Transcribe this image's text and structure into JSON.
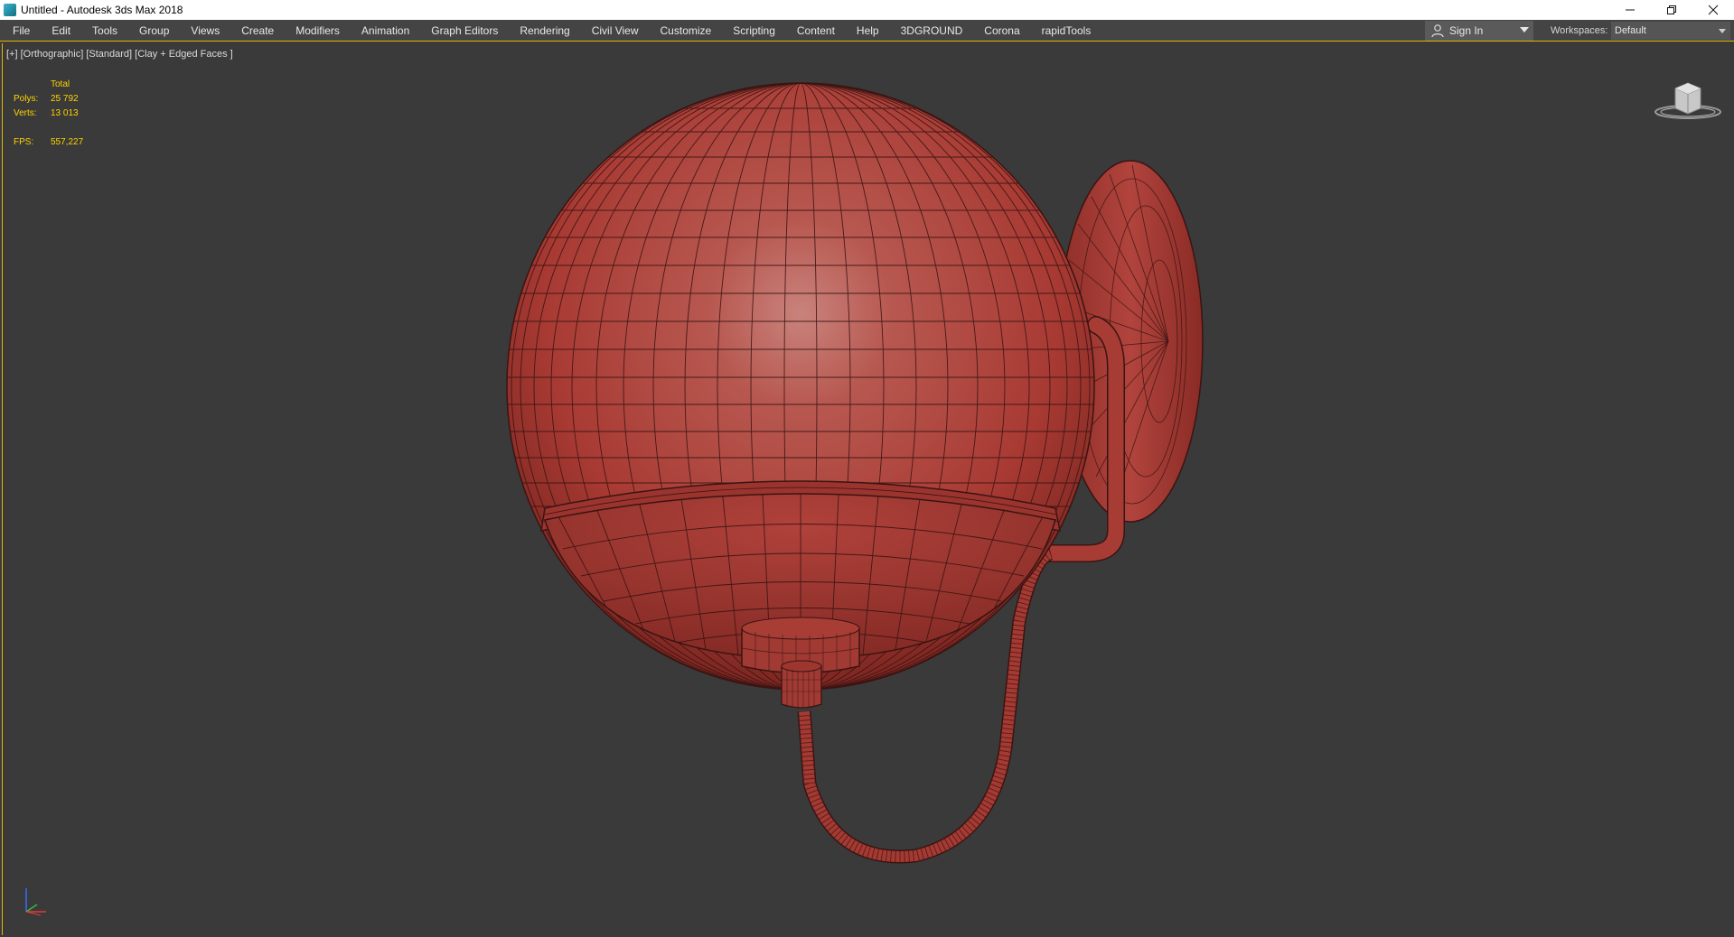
{
  "window": {
    "title": "Untitled - Autodesk 3ds Max 2018",
    "controls": [
      "minimize",
      "restore",
      "close"
    ]
  },
  "menubar": {
    "items": [
      {
        "label": "File"
      },
      {
        "label": "Edit"
      },
      {
        "label": "Tools"
      },
      {
        "label": "Group"
      },
      {
        "label": "Views"
      },
      {
        "label": "Create"
      },
      {
        "label": "Modifiers"
      },
      {
        "label": "Animation"
      },
      {
        "label": "Graph Editors"
      },
      {
        "label": "Rendering"
      },
      {
        "label": "Civil View"
      },
      {
        "label": "Customize"
      },
      {
        "label": "Scripting"
      },
      {
        "label": "Content"
      },
      {
        "label": "Help"
      },
      {
        "label": "3DGROUND"
      },
      {
        "label": "Corona"
      },
      {
        "label": "rapidTools"
      }
    ],
    "sign_in": "Sign In",
    "workspaces_label": "Workspaces:",
    "workspace_value": "Default"
  },
  "viewport": {
    "label": "[+] [Orthographic] [Standard] [Clay + Edged Faces ]",
    "stats": {
      "header": "Total",
      "polys_label": "Polys:",
      "polys_value": "25 792",
      "verts_label": "Verts:",
      "verts_value": "13 013",
      "fps_label": "FPS:",
      "fps_value": "557,227"
    },
    "model_color": "#b5413a",
    "wire_color": "#3a1412",
    "stats_color": "#ffd400",
    "accent_color": "#e6b800"
  }
}
